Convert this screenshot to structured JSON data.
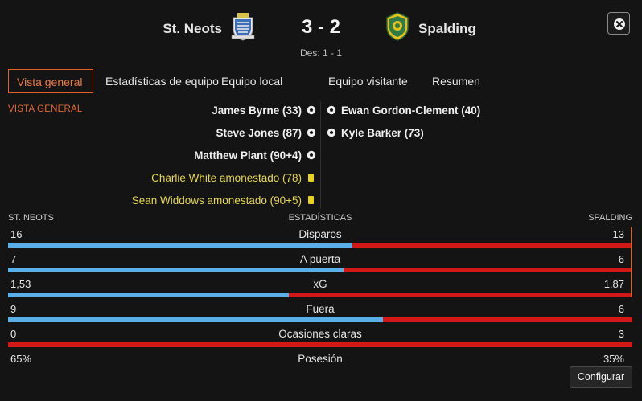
{
  "match": {
    "home_team": "St. Neots",
    "away_team": "Spalding",
    "score": "3 - 2",
    "sub_score": "Des: 1 - 1"
  },
  "tabs": [
    {
      "label": "Vista general",
      "active": true
    },
    {
      "label": "Estadísticas de equipo",
      "active": false
    },
    {
      "label": "Equipo local",
      "active": false
    },
    {
      "label": "Equipo visitante",
      "active": false
    },
    {
      "label": "Resumen",
      "active": false
    }
  ],
  "section_label": "VISTA GENERAL",
  "events": {
    "home": [
      {
        "text": "James Byrne (33)",
        "type": "goal",
        "icon": "football-icon"
      },
      {
        "text": "Steve Jones (87)",
        "type": "goal",
        "icon": "football-icon"
      },
      {
        "text": "Matthew Plant (90+4)",
        "type": "goal",
        "icon": "football-icon"
      },
      {
        "text": "Charlie White amonestado (78)",
        "type": "card",
        "icon": "yellow-card-icon"
      },
      {
        "text": "Sean Widdows amonestado (90+5)",
        "type": "card",
        "icon": "yellow-card-icon"
      }
    ],
    "away": [
      {
        "text": "Ewan Gordon-Clement (40)",
        "type": "goal",
        "icon": "football-icon"
      },
      {
        "text": "Kyle Barker (73)",
        "type": "goal",
        "icon": "football-icon"
      }
    ]
  },
  "stats_header": {
    "home": "ST. NEOTS",
    "center": "ESTADÍSTICAS",
    "away": "SPALDING"
  },
  "stats": [
    {
      "name": "Disparos",
      "home": "16",
      "away": "13",
      "home_fraction": 0.552
    },
    {
      "name": "A puerta",
      "home": "7",
      "away": "6",
      "home_fraction": 0.538
    },
    {
      "name": "xG",
      "home": "1,53",
      "away": "1,87",
      "home_fraction": 0.45
    },
    {
      "name": "Fuera",
      "home": "9",
      "away": "6",
      "home_fraction": 0.6
    },
    {
      "name": "Ocasiones claras",
      "home": "0",
      "away": "3",
      "home_fraction": 0.0
    },
    {
      "name": "Posesión",
      "home": "65%",
      "away": "35%",
      "home_fraction": 0.65,
      "no_bar": true
    }
  ],
  "buttons": {
    "configure": "Configurar"
  },
  "colors": {
    "accent": "#e0632a",
    "home_bar": "#5aafe8",
    "away_bar": "#d31818",
    "yellow_card": "#e8d21a",
    "card_text": "#e6d84a"
  }
}
